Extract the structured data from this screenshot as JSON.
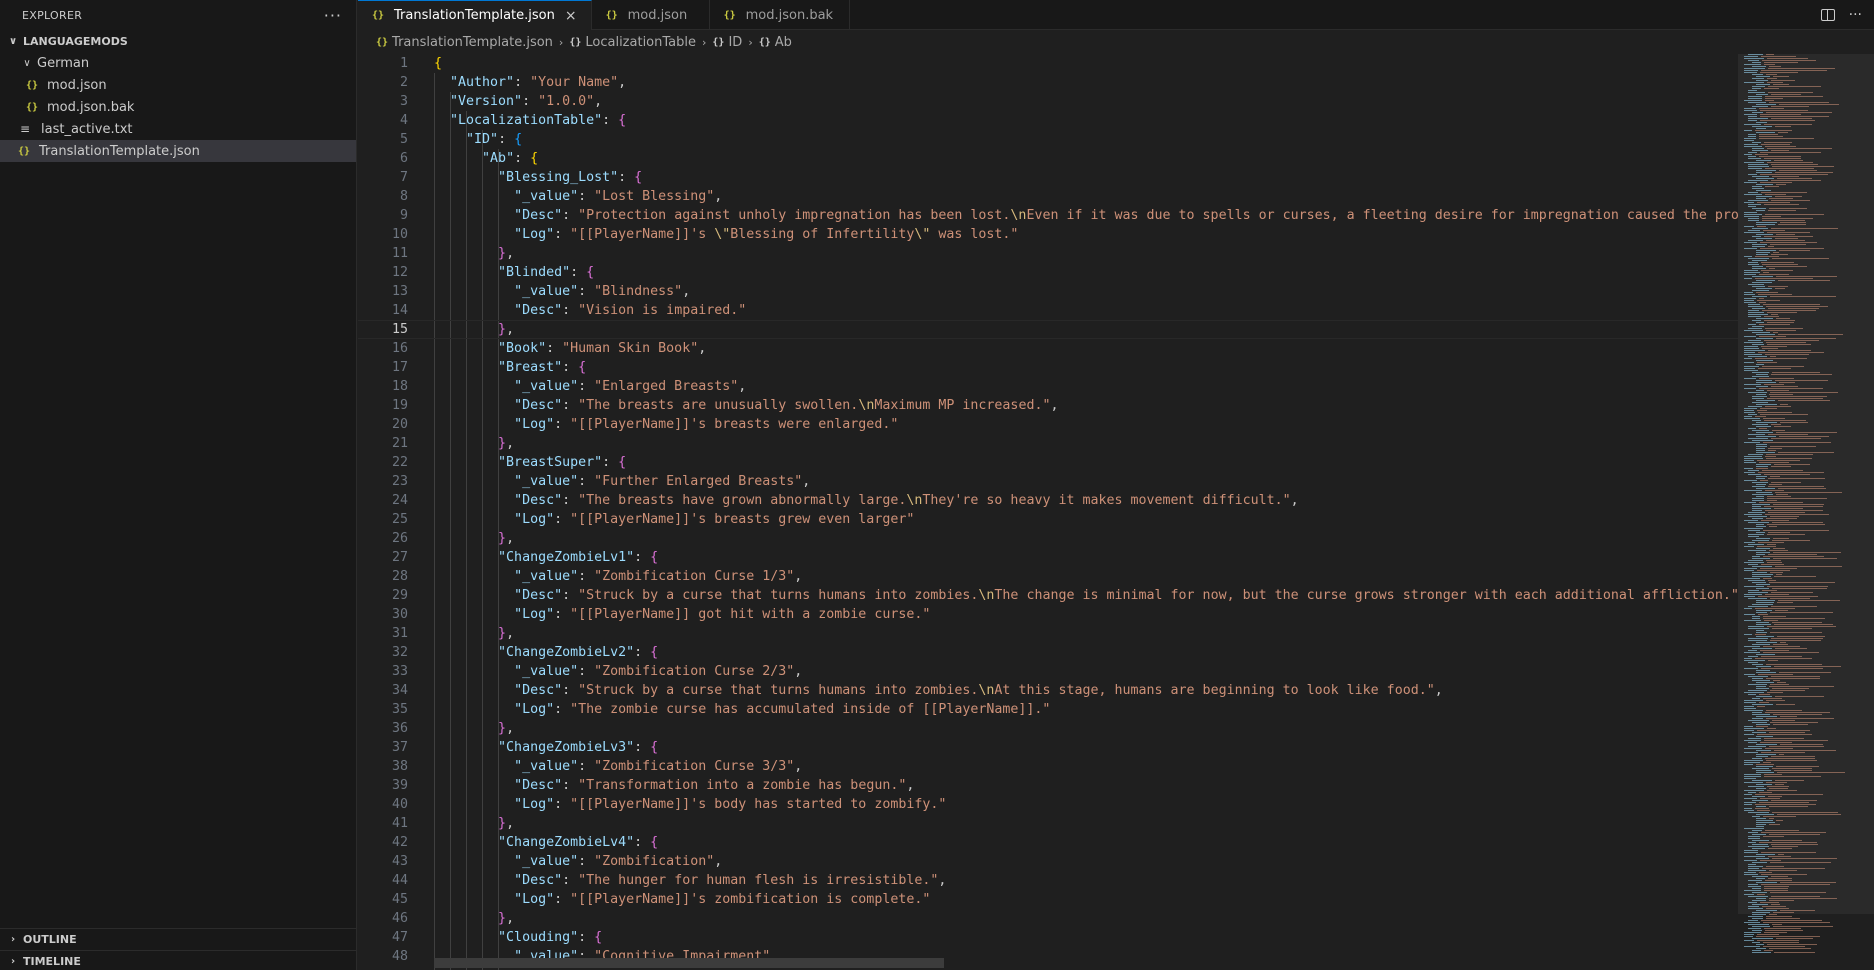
{
  "sidebar": {
    "title": "EXPLORER",
    "more": "···",
    "workspace": "LANGUAGEMODS",
    "items": [
      {
        "label": "German",
        "type": "folder",
        "depth": 1
      },
      {
        "label": "mod.json",
        "type": "json",
        "depth": 2
      },
      {
        "label": "mod.json.bak",
        "type": "json",
        "depth": 2
      },
      {
        "label": "last_active.txt",
        "type": "txt",
        "depth": 1
      },
      {
        "label": "TranslationTemplate.json",
        "type": "json",
        "depth": 1,
        "active": true
      }
    ],
    "outline": "OUTLINE",
    "timeline": "TIMELINE"
  },
  "tabs": [
    {
      "label": "TranslationTemplate.json",
      "active": true,
      "close": "×"
    },
    {
      "label": "mod.json"
    },
    {
      "label": "mod.json.bak"
    }
  ],
  "tab_actions": {
    "more": "···"
  },
  "breadcrumb": [
    "TranslationTemplate.json",
    "LocalizationTable",
    "ID",
    "Ab"
  ],
  "icons": {
    "json": "{}",
    "folder_open": "chevron-down-icon",
    "collapsed": "chevron-right-icon",
    "txt": "lines-icon"
  },
  "current_line": 15,
  "lines": [
    [
      [
        "b1",
        "{"
      ]
    ],
    [
      [
        "p",
        "  "
      ],
      [
        "k",
        "\"Author\""
      ],
      [
        "p",
        ": "
      ],
      [
        "s",
        "\"Your Name\""
      ],
      [
        "p",
        ","
      ]
    ],
    [
      [
        "p",
        "  "
      ],
      [
        "k",
        "\"Version\""
      ],
      [
        "p",
        ": "
      ],
      [
        "s",
        "\"1.0.0\""
      ],
      [
        "p",
        ","
      ]
    ],
    [
      [
        "p",
        "  "
      ],
      [
        "k",
        "\"LocalizationTable\""
      ],
      [
        "p",
        ": "
      ],
      [
        "b2",
        "{"
      ]
    ],
    [
      [
        "p",
        "    "
      ],
      [
        "k",
        "\"ID\""
      ],
      [
        "p",
        ": "
      ],
      [
        "b3",
        "{"
      ]
    ],
    [
      [
        "p",
        "      "
      ],
      [
        "k",
        "\"Ab\""
      ],
      [
        "p",
        ": "
      ],
      [
        "b1",
        "{"
      ]
    ],
    [
      [
        "p",
        "        "
      ],
      [
        "k",
        "\"Blessing_Lost\""
      ],
      [
        "p",
        ": "
      ],
      [
        "b2",
        "{"
      ]
    ],
    [
      [
        "p",
        "          "
      ],
      [
        "k",
        "\"_value\""
      ],
      [
        "p",
        ": "
      ],
      [
        "s",
        "\"Lost Blessing\""
      ],
      [
        "p",
        ","
      ]
    ],
    [
      [
        "p",
        "          "
      ],
      [
        "k",
        "\"Desc\""
      ],
      [
        "p",
        ": "
      ],
      [
        "s",
        "\"Protection against unholy impregnation has been lost."
      ],
      [
        "e",
        "\\n"
      ],
      [
        "s",
        "Even if it was due to spells or curses, a fleeting desire for impregnation caused the protective"
      ]
    ],
    [
      [
        "p",
        "          "
      ],
      [
        "k",
        "\"Log\""
      ],
      [
        "p",
        ": "
      ],
      [
        "s",
        "\"[[PlayerName]]'s "
      ],
      [
        "e",
        "\\\""
      ],
      [
        "s",
        "Blessing of Infertility"
      ],
      [
        "e",
        "\\\""
      ],
      [
        "s",
        " was lost.\""
      ]
    ],
    [
      [
        "p",
        "        "
      ],
      [
        "b2",
        "}"
      ],
      [
        "p",
        ","
      ]
    ],
    [
      [
        "p",
        "        "
      ],
      [
        "k",
        "\"Blinded\""
      ],
      [
        "p",
        ": "
      ],
      [
        "b2",
        "{"
      ]
    ],
    [
      [
        "p",
        "          "
      ],
      [
        "k",
        "\"_value\""
      ],
      [
        "p",
        ": "
      ],
      [
        "s",
        "\"Blindness\""
      ],
      [
        "p",
        ","
      ]
    ],
    [
      [
        "p",
        "          "
      ],
      [
        "k",
        "\"Desc\""
      ],
      [
        "p",
        ": "
      ],
      [
        "s",
        "\"Vision is impaired.\""
      ]
    ],
    [
      [
        "p",
        "        "
      ],
      [
        "b2",
        "}"
      ],
      [
        "p",
        ","
      ]
    ],
    [
      [
        "p",
        "        "
      ],
      [
        "k",
        "\"Book\""
      ],
      [
        "p",
        ": "
      ],
      [
        "s",
        "\"Human Skin Book\""
      ],
      [
        "p",
        ","
      ]
    ],
    [
      [
        "p",
        "        "
      ],
      [
        "k",
        "\"Breast\""
      ],
      [
        "p",
        ": "
      ],
      [
        "b2",
        "{"
      ]
    ],
    [
      [
        "p",
        "          "
      ],
      [
        "k",
        "\"_value\""
      ],
      [
        "p",
        ": "
      ],
      [
        "s",
        "\"Enlarged Breasts\""
      ],
      [
        "p",
        ","
      ]
    ],
    [
      [
        "p",
        "          "
      ],
      [
        "k",
        "\"Desc\""
      ],
      [
        "p",
        ": "
      ],
      [
        "s",
        "\"The breasts are unusually swollen."
      ],
      [
        "e",
        "\\n"
      ],
      [
        "s",
        "Maximum MP increased.\""
      ],
      [
        "p",
        ","
      ]
    ],
    [
      [
        "p",
        "          "
      ],
      [
        "k",
        "\"Log\""
      ],
      [
        "p",
        ": "
      ],
      [
        "s",
        "\"[[PlayerName]]'s breasts were enlarged.\""
      ]
    ],
    [
      [
        "p",
        "        "
      ],
      [
        "b2",
        "}"
      ],
      [
        "p",
        ","
      ]
    ],
    [
      [
        "p",
        "        "
      ],
      [
        "k",
        "\"BreastSuper\""
      ],
      [
        "p",
        ": "
      ],
      [
        "b2",
        "{"
      ]
    ],
    [
      [
        "p",
        "          "
      ],
      [
        "k",
        "\"_value\""
      ],
      [
        "p",
        ": "
      ],
      [
        "s",
        "\"Further Enlarged Breasts\""
      ],
      [
        "p",
        ","
      ]
    ],
    [
      [
        "p",
        "          "
      ],
      [
        "k",
        "\"Desc\""
      ],
      [
        "p",
        ": "
      ],
      [
        "s",
        "\"The breasts have grown abnormally large."
      ],
      [
        "e",
        "\\n"
      ],
      [
        "s",
        "They're so heavy it makes movement difficult.\""
      ],
      [
        "p",
        ","
      ]
    ],
    [
      [
        "p",
        "          "
      ],
      [
        "k",
        "\"Log\""
      ],
      [
        "p",
        ": "
      ],
      [
        "s",
        "\"[[PlayerName]]'s breasts grew even larger\""
      ]
    ],
    [
      [
        "p",
        "        "
      ],
      [
        "b2",
        "}"
      ],
      [
        "p",
        ","
      ]
    ],
    [
      [
        "p",
        "        "
      ],
      [
        "k",
        "\"ChangeZombieLv1\""
      ],
      [
        "p",
        ": "
      ],
      [
        "b2",
        "{"
      ]
    ],
    [
      [
        "p",
        "          "
      ],
      [
        "k",
        "\"_value\""
      ],
      [
        "p",
        ": "
      ],
      [
        "s",
        "\"Zombification Curse 1/3\""
      ],
      [
        "p",
        ","
      ]
    ],
    [
      [
        "p",
        "          "
      ],
      [
        "k",
        "\"Desc\""
      ],
      [
        "p",
        ": "
      ],
      [
        "s",
        "\"Struck by a curse that turns humans into zombies."
      ],
      [
        "e",
        "\\n"
      ],
      [
        "s",
        "The change is minimal for now, but the curse grows stronger with each additional affliction.\""
      ],
      [
        "p",
        ","
      ]
    ],
    [
      [
        "p",
        "          "
      ],
      [
        "k",
        "\"Log\""
      ],
      [
        "p",
        ": "
      ],
      [
        "s",
        "\"[[PlayerName]] got hit with a zombie curse.\""
      ]
    ],
    [
      [
        "p",
        "        "
      ],
      [
        "b2",
        "}"
      ],
      [
        "p",
        ","
      ]
    ],
    [
      [
        "p",
        "        "
      ],
      [
        "k",
        "\"ChangeZombieLv2\""
      ],
      [
        "p",
        ": "
      ],
      [
        "b2",
        "{"
      ]
    ],
    [
      [
        "p",
        "          "
      ],
      [
        "k",
        "\"_value\""
      ],
      [
        "p",
        ": "
      ],
      [
        "s",
        "\"Zombification Curse 2/3\""
      ],
      [
        "p",
        ","
      ]
    ],
    [
      [
        "p",
        "          "
      ],
      [
        "k",
        "\"Desc\""
      ],
      [
        "p",
        ": "
      ],
      [
        "s",
        "\"Struck by a curse that turns humans into zombies."
      ],
      [
        "e",
        "\\n"
      ],
      [
        "s",
        "At this stage, humans are beginning to look like food.\""
      ],
      [
        "p",
        ","
      ]
    ],
    [
      [
        "p",
        "          "
      ],
      [
        "k",
        "\"Log\""
      ],
      [
        "p",
        ": "
      ],
      [
        "s",
        "\"The zombie curse has accumulated inside of [[PlayerName]].\""
      ]
    ],
    [
      [
        "p",
        "        "
      ],
      [
        "b2",
        "}"
      ],
      [
        "p",
        ","
      ]
    ],
    [
      [
        "p",
        "        "
      ],
      [
        "k",
        "\"ChangeZombieLv3\""
      ],
      [
        "p",
        ": "
      ],
      [
        "b2",
        "{"
      ]
    ],
    [
      [
        "p",
        "          "
      ],
      [
        "k",
        "\"_value\""
      ],
      [
        "p",
        ": "
      ],
      [
        "s",
        "\"Zombification Curse 3/3\""
      ],
      [
        "p",
        ","
      ]
    ],
    [
      [
        "p",
        "          "
      ],
      [
        "k",
        "\"Desc\""
      ],
      [
        "p",
        ": "
      ],
      [
        "s",
        "\"Transformation into a zombie has begun.\""
      ],
      [
        "p",
        ","
      ]
    ],
    [
      [
        "p",
        "          "
      ],
      [
        "k",
        "\"Log\""
      ],
      [
        "p",
        ": "
      ],
      [
        "s",
        "\"[[PlayerName]]'s body has started to zombify.\""
      ]
    ],
    [
      [
        "p",
        "        "
      ],
      [
        "b2",
        "}"
      ],
      [
        "p",
        ","
      ]
    ],
    [
      [
        "p",
        "        "
      ],
      [
        "k",
        "\"ChangeZombieLv4\""
      ],
      [
        "p",
        ": "
      ],
      [
        "b2",
        "{"
      ]
    ],
    [
      [
        "p",
        "          "
      ],
      [
        "k",
        "\"_value\""
      ],
      [
        "p",
        ": "
      ],
      [
        "s",
        "\"Zombification\""
      ],
      [
        "p",
        ","
      ]
    ],
    [
      [
        "p",
        "          "
      ],
      [
        "k",
        "\"Desc\""
      ],
      [
        "p",
        ": "
      ],
      [
        "s",
        "\"The hunger for human flesh is irresistible.\""
      ],
      [
        "p",
        ","
      ]
    ],
    [
      [
        "p",
        "          "
      ],
      [
        "k",
        "\"Log\""
      ],
      [
        "p",
        ": "
      ],
      [
        "s",
        "\"[[PlayerName]]'s zombification is complete.\""
      ]
    ],
    [
      [
        "p",
        "        "
      ],
      [
        "b2",
        "}"
      ],
      [
        "p",
        ","
      ]
    ],
    [
      [
        "p",
        "        "
      ],
      [
        "k",
        "\"Clouding\""
      ],
      [
        "p",
        ": "
      ],
      [
        "b2",
        "{"
      ]
    ],
    [
      [
        "p",
        "          "
      ],
      [
        "k",
        "\"_value\""
      ],
      [
        "p",
        ": "
      ],
      [
        "s",
        "\"Cognitive Impairment\""
      ],
      [
        "p",
        ","
      ]
    ]
  ]
}
